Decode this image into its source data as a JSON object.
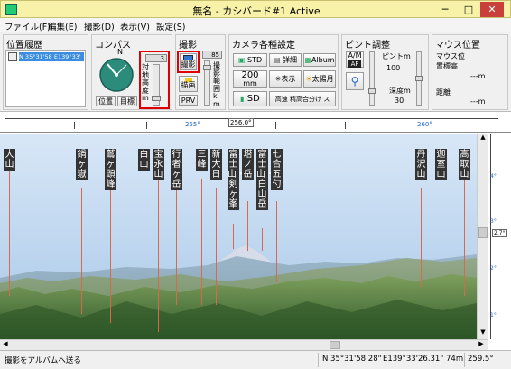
{
  "window": {
    "title": "無名 - カシバード#1 Active",
    "minimize": "─",
    "maximize": "□",
    "close": "✕"
  },
  "menu": [
    "ファイル(F)",
    "編集(E)",
    "撮影(D)",
    "表示(V)",
    "設定(S)"
  ],
  "history": {
    "title": "位置履歴",
    "entry": "N 35°31'58 E139°33'"
  },
  "compass": {
    "title": "コンパス",
    "north": "N",
    "position_btn": "位置",
    "target_btn": "目標",
    "height_label": "対地高度m",
    "height_value": "3"
  },
  "shoot": {
    "title": "撮影",
    "shoot_btn": "撮影",
    "redraw_btn": "描画",
    "prv_btn": "PRV",
    "range_label": "撮影範囲km",
    "range_value": "85"
  },
  "camera": {
    "title": "カメラ各種設定",
    "std": "STD",
    "detail": "詳細",
    "album": "Album",
    "zoom": "200",
    "zoom_unit": "mm",
    "display": "表示",
    "sun_moon": "太陽月",
    "sd": "SD",
    "quality": "高速 精高合分け ス"
  },
  "focus": {
    "title": "ピント調整",
    "af": "A/M",
    "af_sub": "AF",
    "focus_label": "ピントm",
    "focus_value": "100",
    "depth_label": "深度m",
    "depth_value": "30"
  },
  "mouse": {
    "title": "マウス位置",
    "altitude_label": "マウス位置標高",
    "altitude_value": "---m",
    "distance_label": "距離",
    "distance_value": "---m"
  },
  "ruler": {
    "labels": [
      "255°",
      "256.0°",
      "260°"
    ],
    "right_scale": [
      "4°",
      "3°",
      "2.7°",
      "2°",
      "1°"
    ]
  },
  "peaks": [
    "大山",
    "鍋ヶ嶽",
    "鷲ヶ頭峰",
    "白山",
    "宝永山",
    "行者ヶ岳",
    "三峰",
    "新大日",
    "富士山・剣ヶ峯",
    "塔ノ岳",
    "富士山・白山岳",
    "七合五勺",
    "丹沢山",
    "迦室山",
    "高取山"
  ],
  "status": {
    "send": "撮影をアルバムへ送る",
    "lat": "N 35°31'58.28\"",
    "lon": "E139°33'26.31\"",
    "alt": "74m",
    "dir": "259.5°"
  },
  "colors": {
    "titlebar": "#f7f2a8",
    "close": "#c9403a",
    "highlight": "#e00000",
    "sky_top": "#d8e7f7",
    "sky_bottom": "#a9c8e8"
  }
}
